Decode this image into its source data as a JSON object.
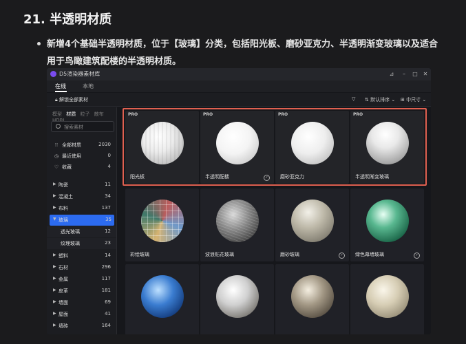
{
  "article": {
    "heading": "21. 半透明材质",
    "description": "新增4个基础半透明材质，位于【玻璃】分类，包括阳光板、磨砂亚克力、半透明渐变玻璃以及适合用于鸟瞰建筑配楼的半透明材质。"
  },
  "window": {
    "title": "D5渲染器素材库",
    "controls": [
      "pin-icon",
      "minimize-icon",
      "maximize-icon",
      "close-icon"
    ]
  },
  "tabs": [
    "在线",
    "本地"
  ],
  "toolbar": {
    "unlock_label": "解锁全部素材",
    "sort_label": "默认排序",
    "size_label": "中尺寸"
  },
  "sidebar": {
    "category_tabs": [
      "模型",
      "材质",
      "粒子",
      "散布",
      "HDRI"
    ],
    "active_category": "材质",
    "search_placeholder": "搜索素材",
    "top_items": [
      {
        "label": "全部材质",
        "count": "2030",
        "icon": "grid-icon"
      },
      {
        "label": "最近使用",
        "count": "0",
        "icon": "clock-icon"
      },
      {
        "label": "收藏",
        "count": "4",
        "icon": "heart-icon"
      }
    ],
    "folders": [
      {
        "label": "陶瓷",
        "count": "11"
      },
      {
        "label": "混凝土",
        "count": "34"
      },
      {
        "label": "布料",
        "count": "137"
      },
      {
        "label": "玻璃",
        "count": "35",
        "selected": true
      },
      {
        "label": "透光玻璃",
        "count": "12",
        "sub": true
      },
      {
        "label": "纹理玻璃",
        "count": "23",
        "sub": true
      },
      {
        "label": "塑料",
        "count": "14"
      },
      {
        "label": "石材",
        "count": "296"
      },
      {
        "label": "金属",
        "count": "117"
      },
      {
        "label": "皮革",
        "count": "181"
      },
      {
        "label": "墙面",
        "count": "69"
      },
      {
        "label": "屋面",
        "count": "41"
      },
      {
        "label": "墙砖",
        "count": "164"
      }
    ]
  },
  "materials": [
    {
      "name": "阳光板",
      "pro": "PRO",
      "check": false
    },
    {
      "name": "半透明配楼",
      "pro": "PRO",
      "check": true
    },
    {
      "name": "磨砂亚克力",
      "pro": "PRO",
      "check": false
    },
    {
      "name": "半透明渐变玻璃",
      "pro": "PRO",
      "check": false
    },
    {
      "name": "彩绘玻璃",
      "pro": "",
      "check": false
    },
    {
      "name": "波浪贴花玻璃",
      "pro": "",
      "check": false
    },
    {
      "name": "磨砂玻璃",
      "pro": "",
      "check": true
    },
    {
      "name": "绿色幕墙玻璃",
      "pro": "",
      "check": true
    },
    {
      "name": "",
      "pro": "",
      "check": false
    },
    {
      "name": "",
      "pro": "",
      "check": false
    },
    {
      "name": "",
      "pro": "",
      "check": false
    },
    {
      "name": "",
      "pro": "",
      "check": false
    }
  ],
  "colors": {
    "highlight_border": "#e06050",
    "selected_folder": "#2c6bf0",
    "app_logo": "#7a4cf0"
  }
}
